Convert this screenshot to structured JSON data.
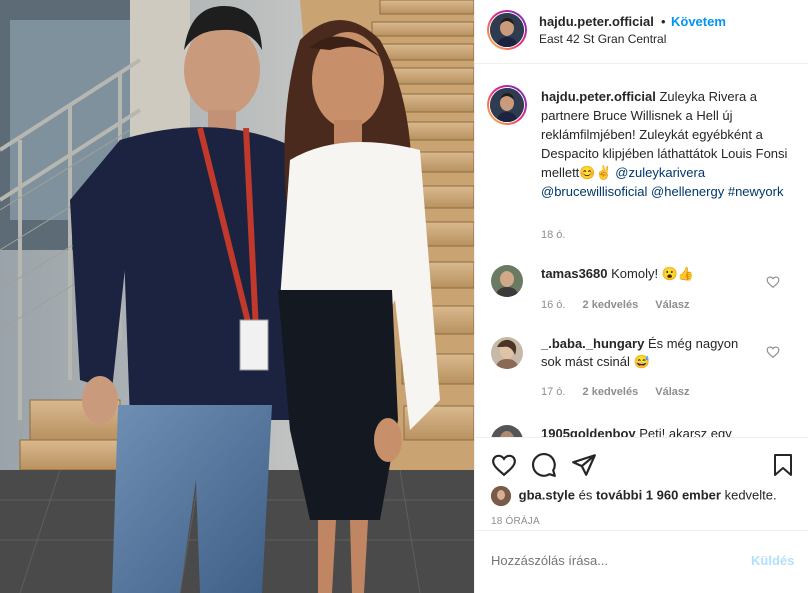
{
  "header": {
    "username": "hajdu.peter.official",
    "dot": "•",
    "follow_label": "Követem",
    "location": "East 42 St Gran Central"
  },
  "caption": {
    "username": "hajdu.peter.official",
    "text": "Zuleyka Rivera a partnere Bruce Willisnek a Hell új reklámfilmjében! Zuleykát egyébként a Despacito klipjében láthattátok Louis Fonsi mellett",
    "emoji": "😊✌",
    "mentions": [
      "@zuleykarivera",
      "@brucewillisoficial",
      "@hellenergy"
    ],
    "hashtag": "#newyork",
    "time": "18 ó."
  },
  "comments": [
    {
      "username": "tamas3680",
      "text": "Komoly! 😮👍",
      "time": "16 ó.",
      "likes": "2 kedvelés",
      "reply": "Válasz"
    },
    {
      "username": "_.baba._hungary",
      "text": "És még nagyon sok mást csinál 😅",
      "time": "17 ó.",
      "likes": "2 kedvelés",
      "reply": "Válasz"
    },
    {
      "username": "1905goldenboy",
      "text": "Peti! akarsz egy"
    }
  ],
  "likes": {
    "user": "gba.style",
    "middle": "és",
    "others": "további 1 960 ember",
    "suffix": "kedvelte."
  },
  "post_time": "18 ÓRÁJA",
  "add_comment": {
    "placeholder": "Hozzászólás írása...",
    "post_label": "Küldés"
  },
  "icons": {
    "like": "heart-icon",
    "comment": "comment-icon",
    "share": "share-icon",
    "save": "bookmark-icon",
    "comment_like": "heart-icon"
  },
  "colors": {
    "link": "#00376b",
    "follow": "#0095f6",
    "post_disabled": "#b2dffc",
    "muted": "#8e8e8e"
  }
}
